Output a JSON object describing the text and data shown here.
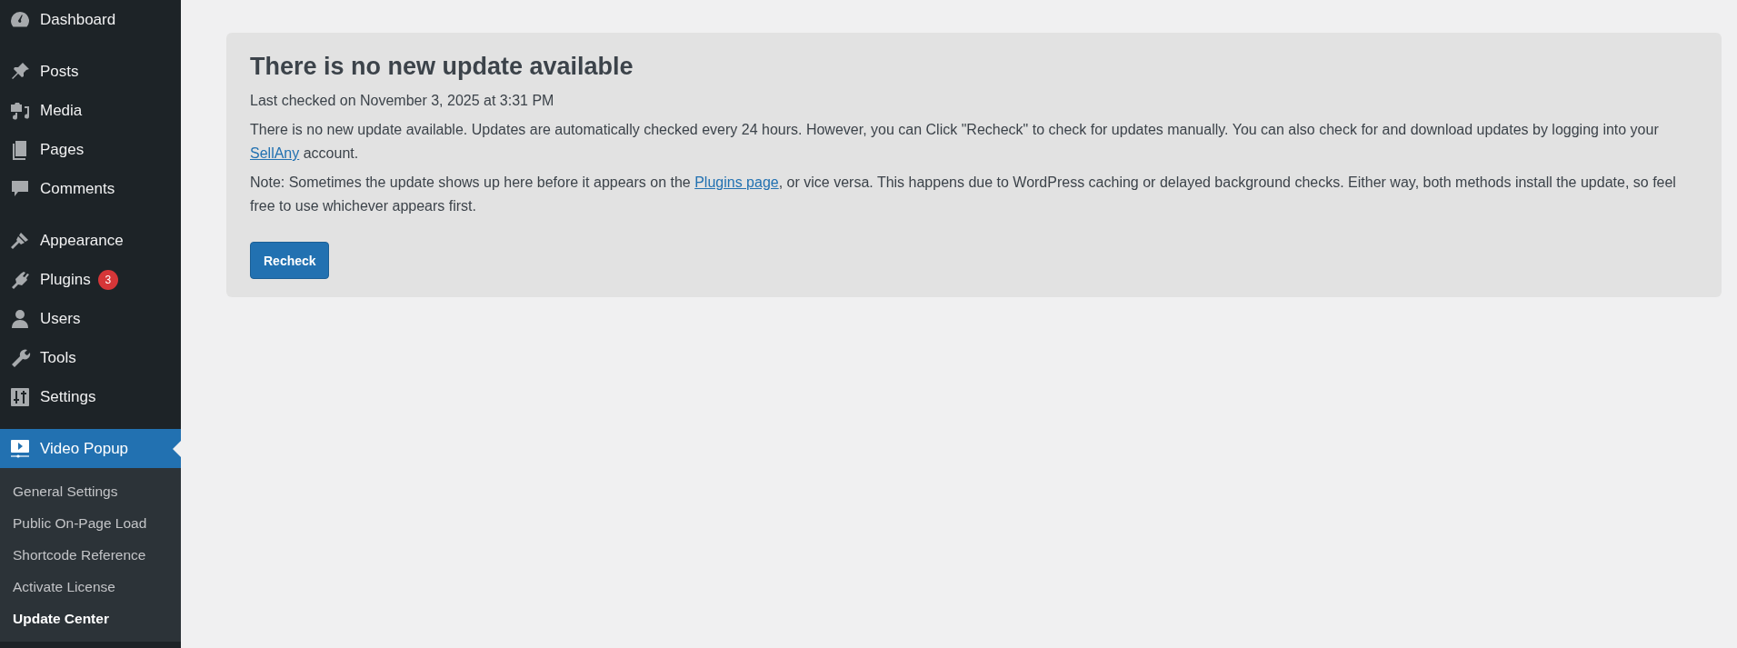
{
  "sidebar": {
    "menu_groups": [
      {
        "items": [
          {
            "label": "Dashboard",
            "selected": false
          }
        ]
      },
      {
        "items": [
          {
            "label": "Posts",
            "selected": false
          },
          {
            "label": "Media",
            "selected": false
          },
          {
            "label": "Pages",
            "selected": false
          },
          {
            "label": "Comments",
            "selected": false
          }
        ]
      },
      {
        "items": [
          {
            "label": "Appearance",
            "selected": false
          },
          {
            "label": "Plugins",
            "selected": false,
            "badge": "3"
          },
          {
            "label": "Users",
            "selected": false
          },
          {
            "label": "Tools",
            "selected": false
          },
          {
            "label": "Settings",
            "selected": false
          }
        ]
      },
      {
        "items": [
          {
            "label": "Video Popup",
            "selected": true,
            "submenu": [
              {
                "label": "General Settings",
                "selected": false
              },
              {
                "label": "Public On-Page Load",
                "selected": false
              },
              {
                "label": "Shortcode Reference",
                "selected": false
              },
              {
                "label": "Activate License",
                "selected": false
              },
              {
                "label": "Update Center",
                "selected": true
              }
            ]
          }
        ]
      }
    ]
  },
  "notice": {
    "title": "There is no new update available",
    "last_checked": "Last checked on November 3, 2025 at 3:31 PM",
    "paragraphs": [
      {
        "parts": [
          {
            "text": "There is no new update available. Updates are automatically checked every 24 hours. However, you can Click \"Recheck\" to check for updates manually. You can also check for and download updates by logging into your "
          },
          {
            "link": "SellAny"
          },
          {
            "text": " account."
          }
        ]
      },
      {
        "parts": [
          {
            "text": "Note: Sometimes the update shows up here before it appears on the "
          },
          {
            "link": "Plugins page"
          },
          {
            "text": ", or vice versa. This happens due to WordPress caching or delayed background checks. Either way, both methods install the update, so feel free to use whichever appears first."
          }
        ]
      }
    ],
    "button": "Recheck"
  }
}
